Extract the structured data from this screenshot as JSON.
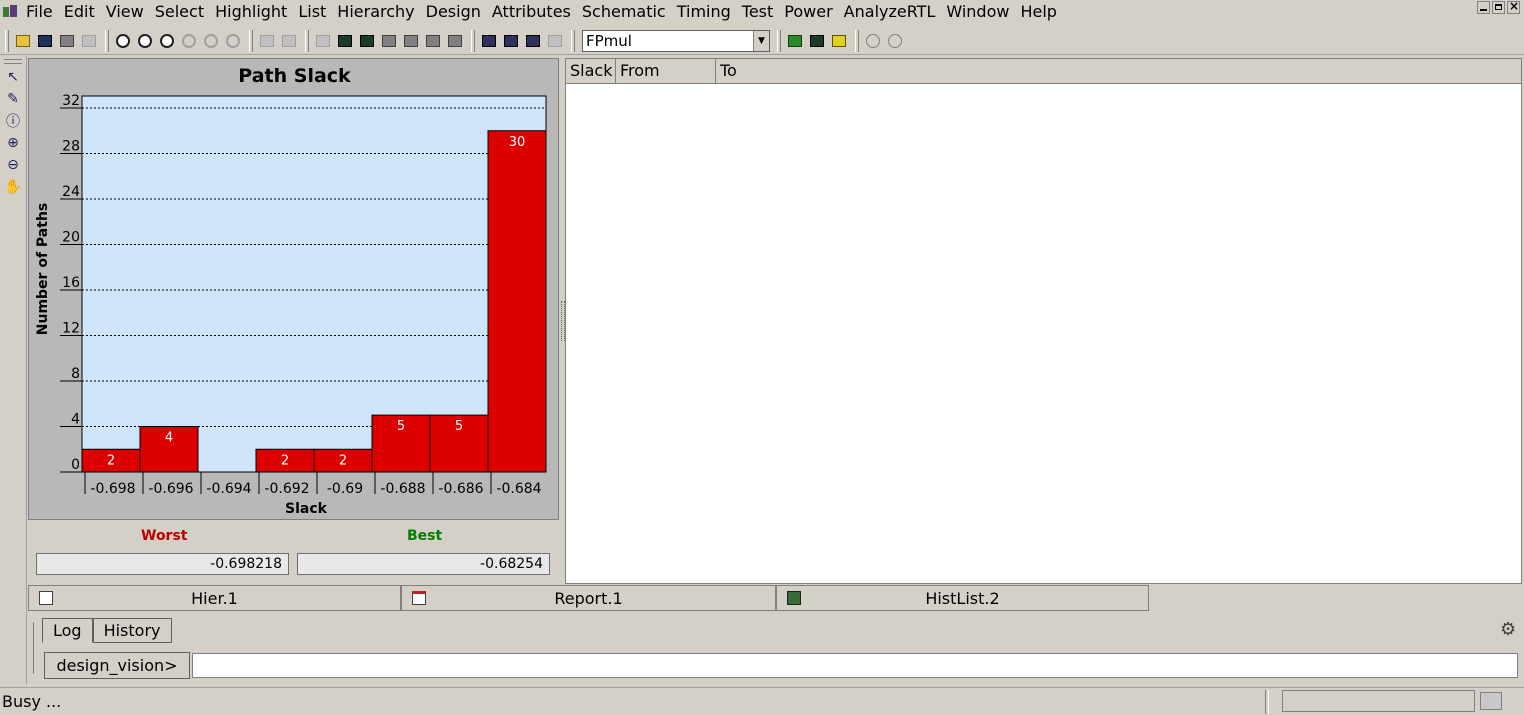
{
  "menu": [
    "File",
    "Edit",
    "View",
    "Select",
    "Highlight",
    "List",
    "Hierarchy",
    "Design",
    "Attributes",
    "Schematic",
    "Timing",
    "Test",
    "Power",
    "AnalyzeRTL",
    "Window",
    "Help"
  ],
  "toolbar": {
    "design_value": "FPmul"
  },
  "chart_data": {
    "type": "bar",
    "title": "Path Slack",
    "xlabel": "Slack",
    "ylabel": "Number of Paths",
    "categories": [
      "-0.698",
      "-0.696",
      "-0.694",
      "-0.692",
      "-0.69",
      "-0.688",
      "-0.686",
      "-0.684"
    ],
    "values": [
      2,
      4,
      0,
      2,
      2,
      5,
      5,
      30
    ],
    "ylim": [
      0,
      32
    ],
    "yticks": [
      0,
      4,
      8,
      12,
      16,
      20,
      24,
      28,
      32
    ],
    "grid": true,
    "colors": {
      "bar": "#dd0000",
      "plot_bg": "#cde4fa"
    }
  },
  "summary": {
    "worst_label": "Worst",
    "worst_value": "-0.698218",
    "best_label": "Best",
    "best_value": "-0.68254",
    "worst_color": "#c00000",
    "best_color": "#008000"
  },
  "table": {
    "columns": [
      "Slack",
      "From",
      "To"
    ]
  },
  "doc_tabs": [
    {
      "label": "Hier.1",
      "icon": "hierarchy-icon"
    },
    {
      "label": "Report.1",
      "icon": "report-icon"
    },
    {
      "label": "HistList.2",
      "icon": "histogram-icon"
    }
  ],
  "console": {
    "tabs": [
      "Log",
      "History"
    ],
    "prompt": "design_vision>",
    "command_value": ""
  },
  "status": {
    "text": "Busy ..."
  }
}
